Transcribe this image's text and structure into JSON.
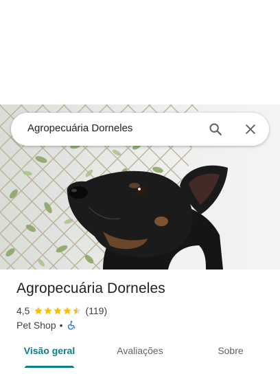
{
  "search": {
    "query": "Agropecuária Dorneles"
  },
  "place": {
    "name": "Agropecuária Dorneles",
    "rating": "4,5",
    "stars": 4.5,
    "reviews_count": "(119)",
    "category": "Pet Shop",
    "separator": "•"
  },
  "tabs": [
    {
      "label": "Visão geral",
      "active": true
    },
    {
      "label": "Avaliações",
      "active": false
    },
    {
      "label": "Sobre",
      "active": false
    }
  ],
  "colors": {
    "accent": "#0b7f8a",
    "star": "#fbbc04",
    "accessible_icon": "#1a73e8"
  },
  "icons": {
    "search": "search-icon",
    "close": "close-icon",
    "accessible": "wheelchair-accessible-icon"
  }
}
